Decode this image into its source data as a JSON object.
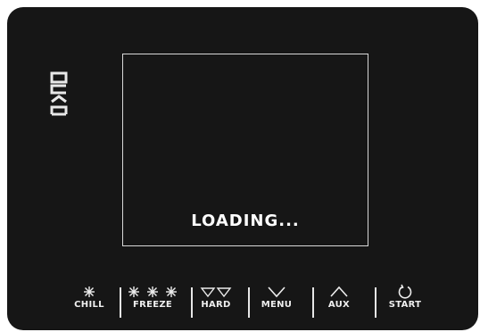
{
  "device": {
    "brand": "EVCO",
    "display": {
      "status_text": "LOADING..."
    },
    "keys": [
      {
        "id": "chill",
        "label": "CHILL",
        "icon": "snowflake-icon"
      },
      {
        "id": "freeze",
        "label": "FREEZE",
        "icon": "triple-snowflake-icon"
      },
      {
        "id": "hard",
        "label": "HARD",
        "icon": "double-down-triangle-icon"
      },
      {
        "id": "menu",
        "label": "MENU",
        "icon": "chevron-down-icon"
      },
      {
        "id": "aux",
        "label": "AUX",
        "icon": "chevron-up-icon"
      },
      {
        "id": "start",
        "label": "START",
        "icon": "power-restart-icon"
      }
    ],
    "colors": {
      "panel": "#161616",
      "text": "#ffffff",
      "screen_border": "#d8d8d8"
    }
  }
}
